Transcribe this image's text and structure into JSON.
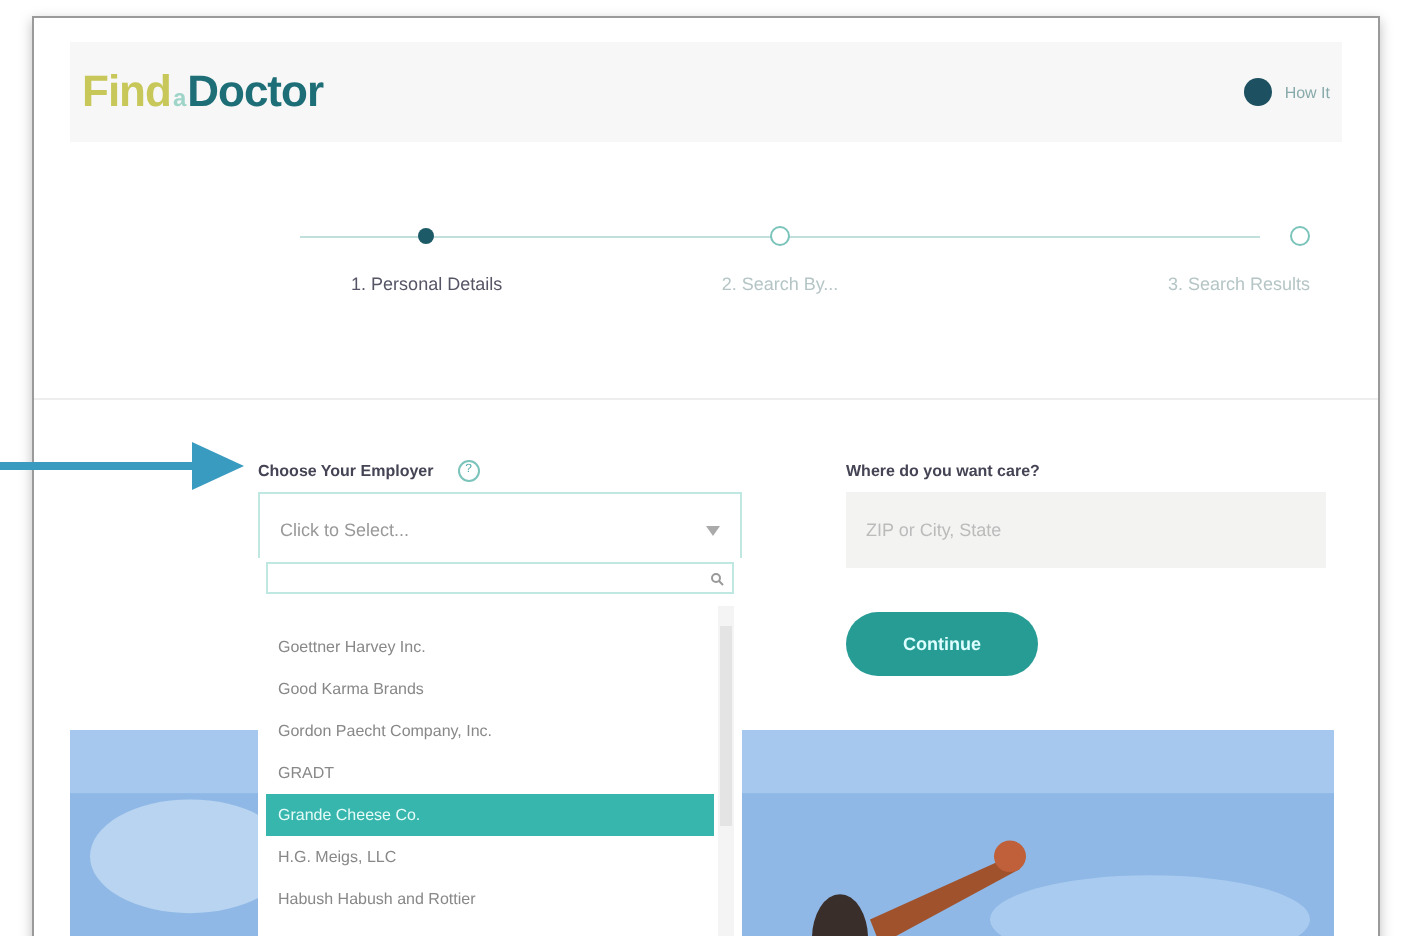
{
  "header": {
    "logo": {
      "first": "Find",
      "middle": "a",
      "last": "Doctor"
    },
    "user_link": "How It"
  },
  "steps": [
    {
      "label": "1. Personal Details",
      "selected": true
    },
    {
      "label": "2. Search By...",
      "selected": false
    },
    {
      "label": "3. Search Results",
      "selected": false
    }
  ],
  "employer": {
    "label": "Choose Your Employer",
    "help": "?",
    "placeholder": "Click to Select...",
    "options": [
      {
        "label": "Goettner Harvey Inc.",
        "selected": false
      },
      {
        "label": "Good Karma Brands",
        "selected": false
      },
      {
        "label": "Gordon Paecht Company, Inc.",
        "selected": false
      },
      {
        "label": "GRADT",
        "selected": false
      },
      {
        "label": "Grande Cheese Co.",
        "selected": true
      },
      {
        "label": "H.G. Meigs, LLC",
        "selected": false
      },
      {
        "label": "Habush Habush and Rottier",
        "selected": false
      }
    ]
  },
  "location": {
    "label": "Where do you want care?",
    "placeholder": "ZIP or City, State"
  },
  "continue_button": "Continue"
}
